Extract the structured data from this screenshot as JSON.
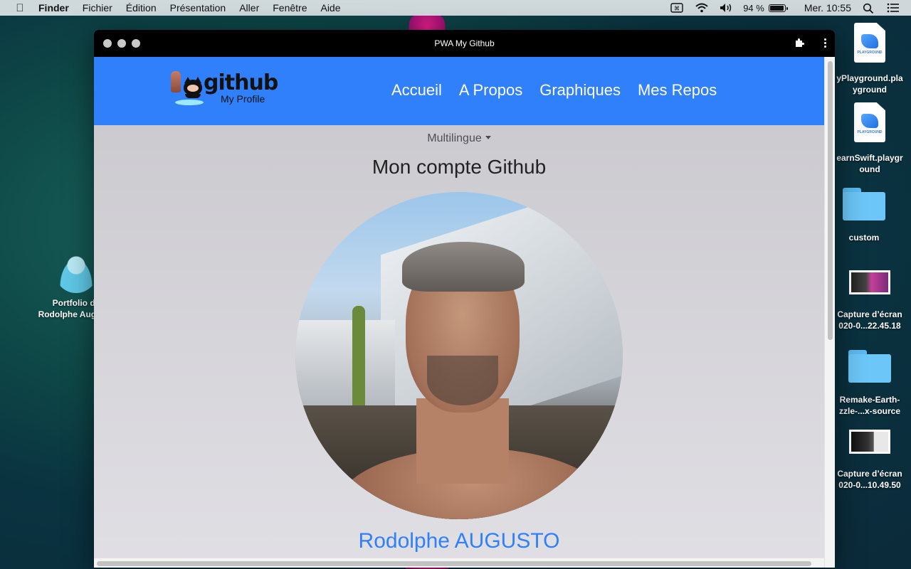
{
  "menubar": {
    "app_name": "Finder",
    "menus": [
      "Fichier",
      "Édition",
      "Présentation",
      "Aller",
      "Fenêtre",
      "Aide"
    ],
    "battery_percent": "94 %",
    "clock": "Mer. 10:55"
  },
  "desktop": {
    "left_items": [
      {
        "label": "Portfolio de\nRodolphe Augusto"
      }
    ],
    "right_items": [
      {
        "label": "yPlayground.pla\nyground"
      },
      {
        "label": "earnSwift.playgr\nound"
      },
      {
        "label": "custom"
      },
      {
        "label": "Capture d’écran\n020-0...22.45.18"
      },
      {
        "label": "Remake-Earth-\nzzle-...x-source"
      },
      {
        "label": "Capture d’écran\n020-0...10.49.50"
      }
    ]
  },
  "window": {
    "title": "PWA My Github"
  },
  "navbar": {
    "brand_word": "github",
    "brand_sub": "My Profile",
    "links": [
      "Accueil",
      "A Propos",
      "Graphiques",
      "Mes Repos"
    ]
  },
  "page": {
    "language_dropdown": "Multilingue",
    "title": "Mon compte Github",
    "profile_name": "Rodolphe AUGUSTO"
  },
  "colors": {
    "brand_blue": "#2f80fa",
    "titlebar": "#000000",
    "page_background": "#d0cfd4"
  }
}
